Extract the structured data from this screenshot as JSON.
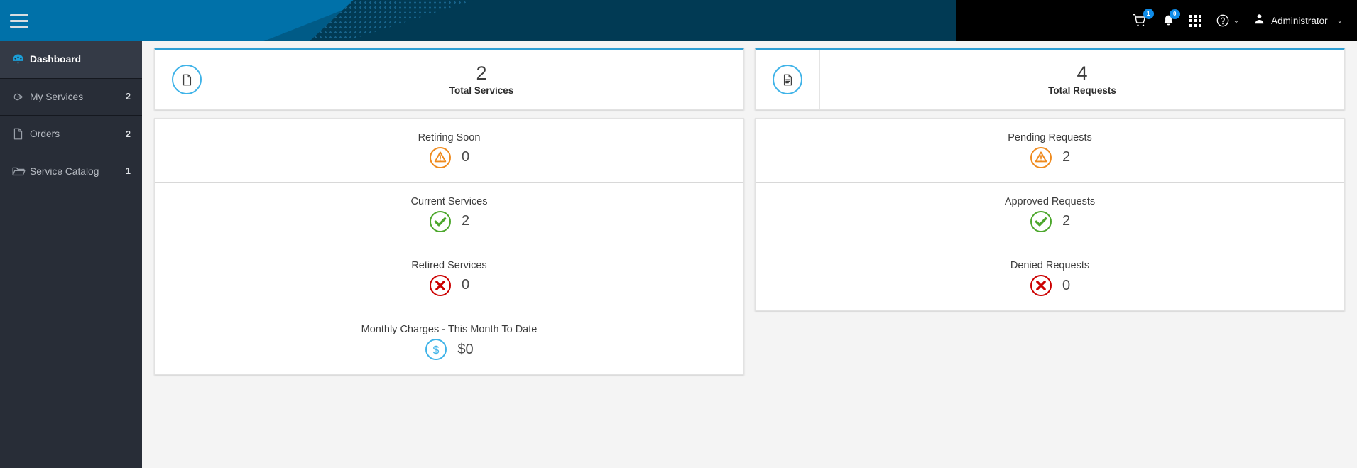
{
  "header": {
    "menu_icon": "hamburger-icon",
    "cart_icon": "shopping-cart-icon",
    "cart_badge": "1",
    "bell_icon": "notification-bell-icon",
    "bell_badge": "0",
    "apps_icon": "apps-grid-icon",
    "help_icon": "help-circle-icon",
    "help_chevron": "⌄",
    "user_icon": "user-avatar-icon",
    "user_name": "Administrator",
    "user_chevron": "⌄"
  },
  "sidebar": {
    "items": [
      {
        "label": "Dashboard",
        "count": "",
        "icon": "dashboard-gauge-icon",
        "active": true
      },
      {
        "label": "My Services",
        "count": "2",
        "icon": "my-services-icon",
        "active": false
      },
      {
        "label": "Orders",
        "count": "2",
        "icon": "orders-document-icon",
        "active": false
      },
      {
        "label": "Service Catalog",
        "count": "1",
        "icon": "service-catalog-folder-icon",
        "active": false
      }
    ]
  },
  "main": {
    "left": {
      "summary": {
        "value": "2",
        "label": "Total Services",
        "icon": "document-blank-icon"
      },
      "stats": [
        {
          "title": "Retiring Soon",
          "value": "0",
          "icon": "warning-triangle-icon",
          "color": "#ef8b1f"
        },
        {
          "title": "Current Services",
          "value": "2",
          "icon": "check-circle-icon",
          "color": "#4ca72c"
        },
        {
          "title": "Retired Services",
          "value": "0",
          "icon": "x-circle-icon",
          "color": "#cc0000"
        },
        {
          "title": "Monthly Charges - This Month To Date",
          "value": "$0",
          "icon": "dollar-circle-icon",
          "color": "#3fb3e8"
        }
      ]
    },
    "right": {
      "summary": {
        "value": "4",
        "label": "Total Requests",
        "icon": "document-lines-icon"
      },
      "stats": [
        {
          "title": "Pending Requests",
          "value": "2",
          "icon": "warning-triangle-icon",
          "color": "#ef8b1f"
        },
        {
          "title": "Approved Requests",
          "value": "2",
          "icon": "check-circle-icon",
          "color": "#4ca72c"
        },
        {
          "title": "Denied Requests",
          "value": "0",
          "icon": "x-circle-icon",
          "color": "#cc0000"
        }
      ]
    }
  },
  "colors": {
    "accent": "#2f9fd4",
    "header_blue": "#0071a9",
    "header_navy": "#013a54",
    "sidebar_bg": "#282d37"
  }
}
